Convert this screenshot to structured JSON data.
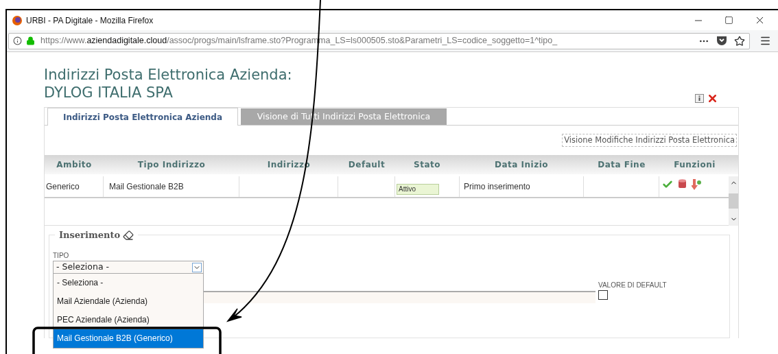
{
  "window": {
    "title": "URBI - PA Digitale - Mozilla Firefox"
  },
  "address_bar": {
    "url_parts": [
      {
        "text": "https://www.",
        "emphasis": false
      },
      {
        "text": "aziendadigitale.cloud",
        "emphasis": true
      },
      {
        "text": "/assoc/progs/main/lsframe.sto?Programma_LS=ls000505.sto&Parametri_LS=codice_soggetto=1^tipo_",
        "emphasis": false
      }
    ]
  },
  "page": {
    "heading": [
      "Indirizzi Posta Elettronica Azienda:",
      "DYLOG ITALIA SPA"
    ],
    "tabs": [
      {
        "label": "Indirizzi Posta Elettronica Azienda",
        "selected": true
      },
      {
        "label": "Visione di Tutti Indirizzi Posta Elettronica",
        "selected": false
      }
    ],
    "changes_link": "Visione Modifiche Indirizzi Posta Elettronica",
    "table": {
      "columns": [
        "Ambito",
        "Tipo Indirizzo",
        "Indirizzo",
        "Default",
        "Stato",
        "Data Inizio",
        "Data Fine",
        "Funzioni"
      ],
      "rows": [
        {
          "ambito": "Generico",
          "tipo_indirizzo": "Mail Gestionale B2B",
          "stato": "Attivo",
          "data_inizio": "Primo inserimento"
        }
      ]
    },
    "insert_section": {
      "title": "Inserimento",
      "tipo_label": "TIPO",
      "tipo_value": "- Seleziona -",
      "options": [
        {
          "label": "- Seleziona -",
          "selected": false
        },
        {
          "label": "Mail Aziendale (Azienda)",
          "selected": false
        },
        {
          "label": "PEC Aziendale (Azienda)",
          "selected": false
        },
        {
          "label": "Mail Gestionale B2B (Generico)",
          "selected": true
        }
      ],
      "default_label": "VALORE DI DEFAULT",
      "default_checked": false
    }
  }
}
